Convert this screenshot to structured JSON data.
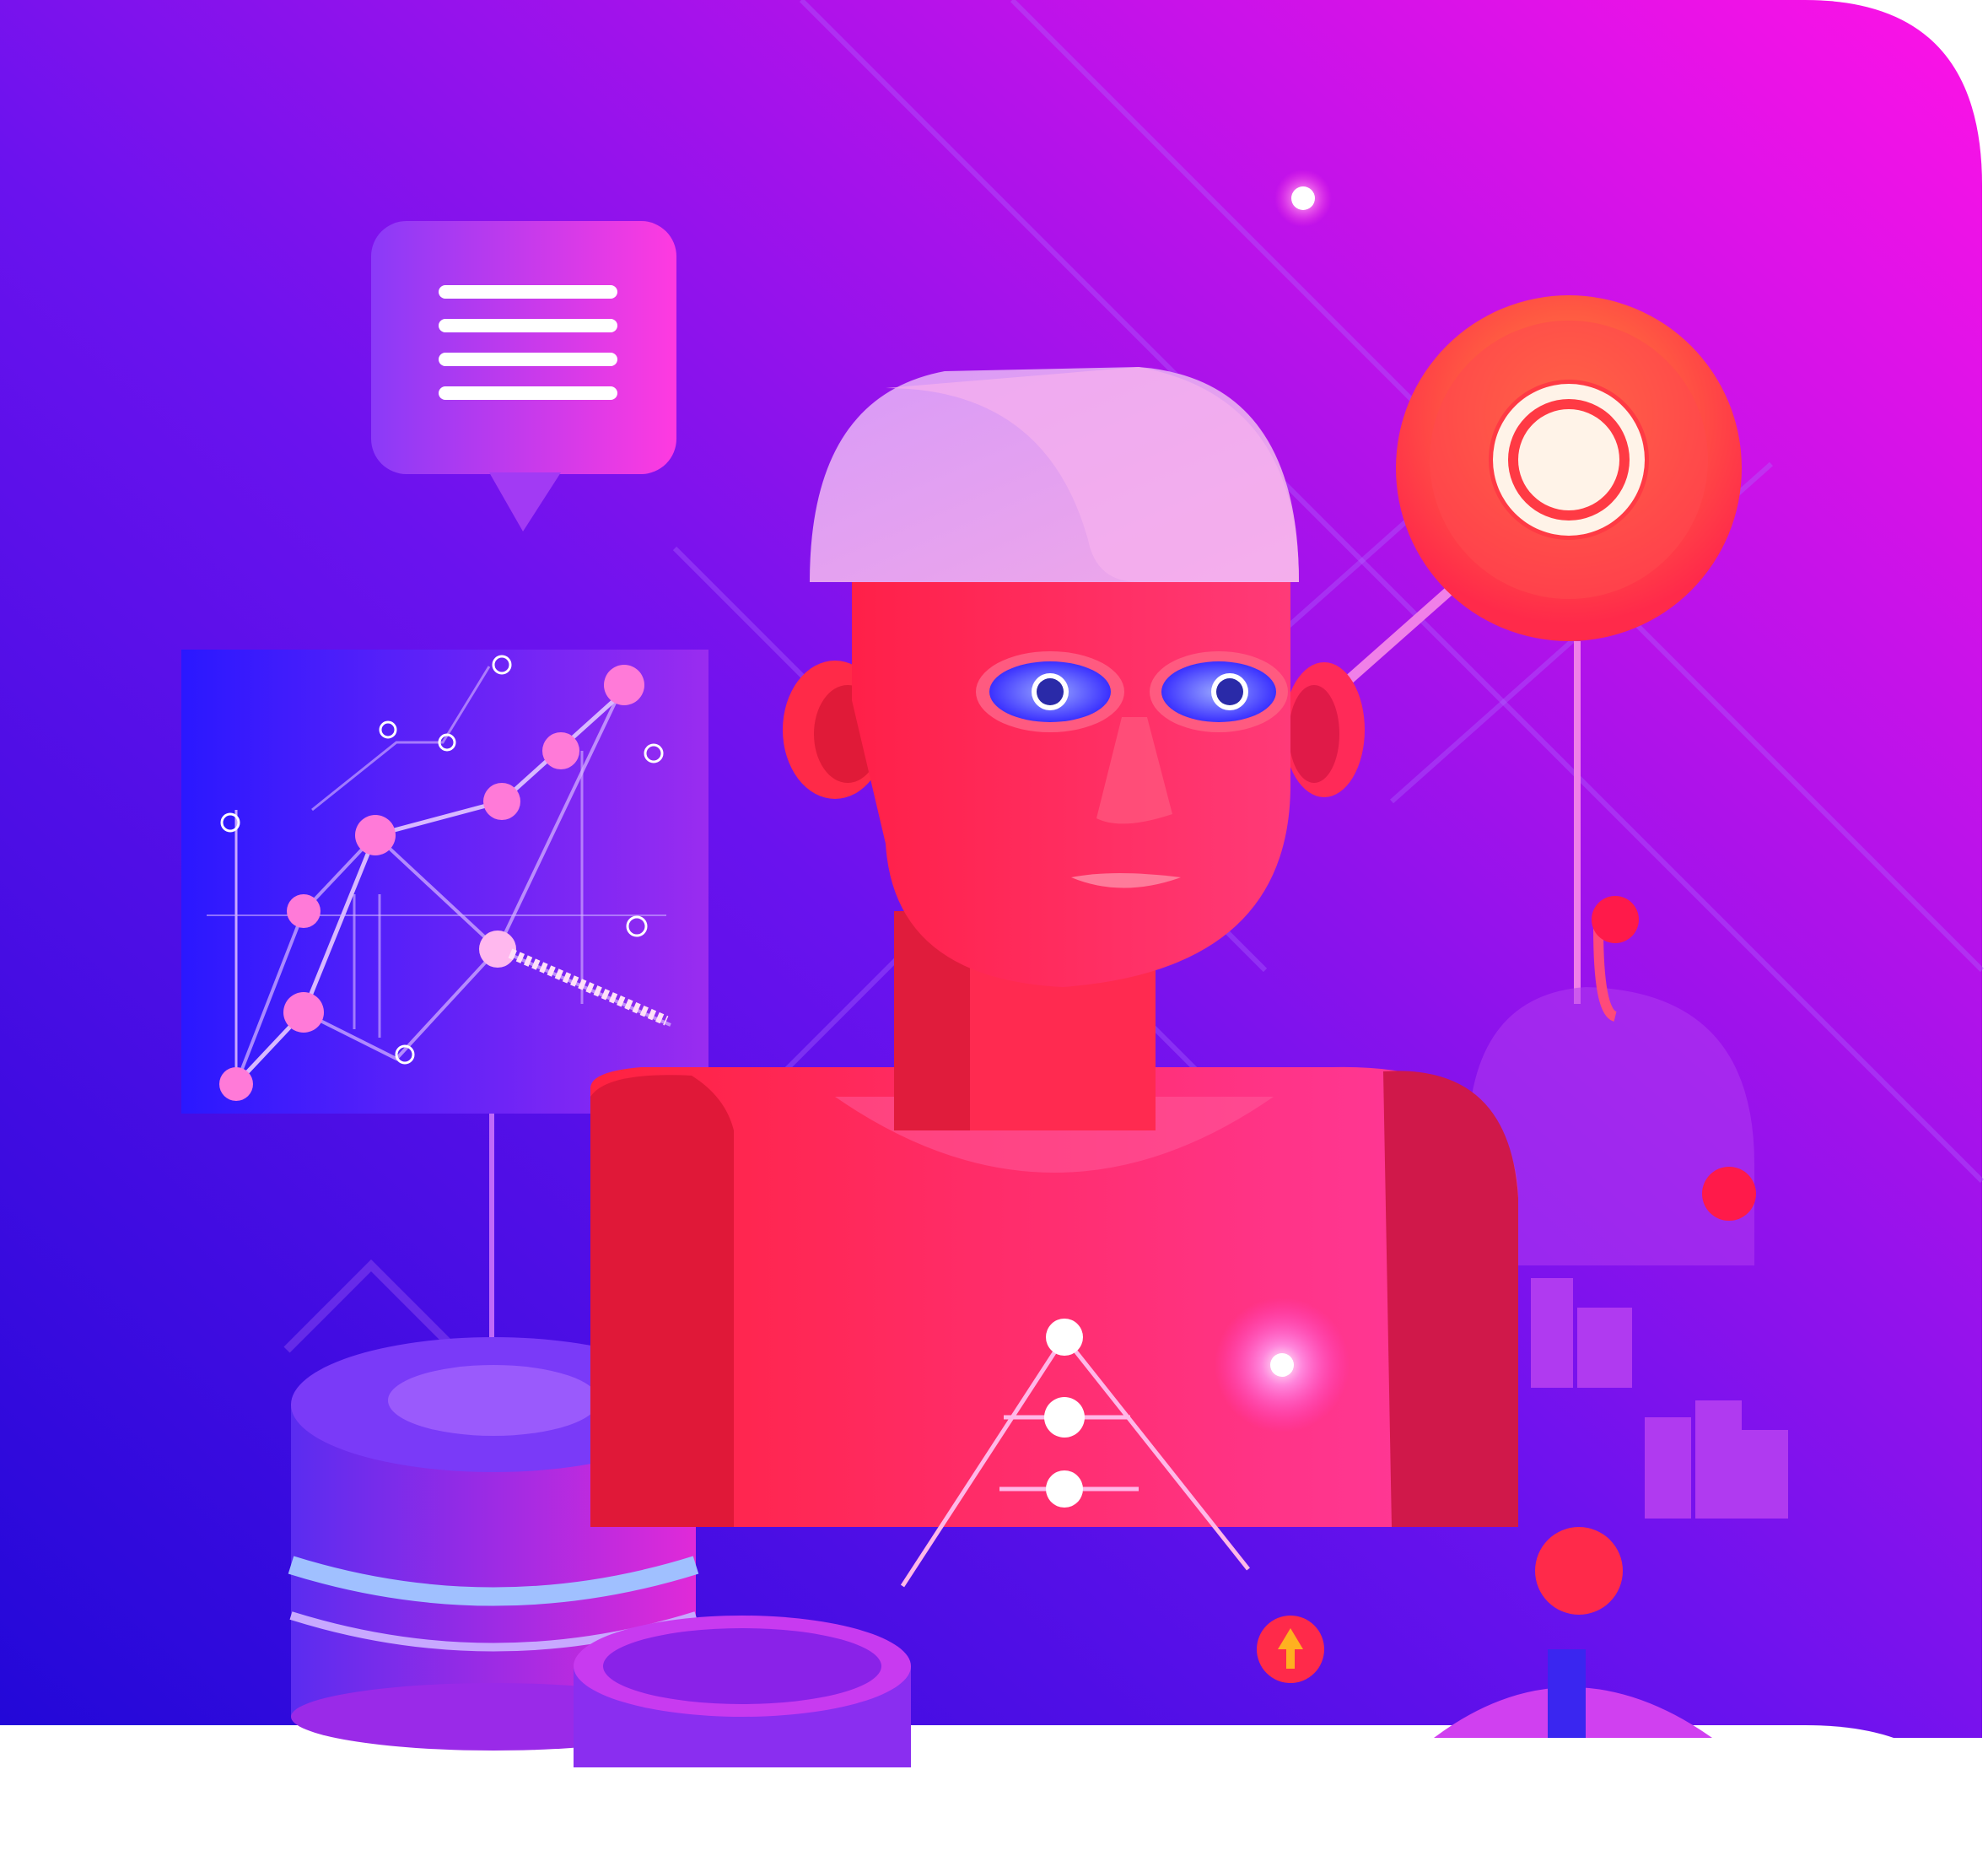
{
  "colors": {
    "bg_left": "#2a10e0",
    "bg_mid": "#7a10f0",
    "bg_right": "#ff10e8",
    "robot_red": "#ff2a55",
    "robot_hair": "#f0a0e8",
    "eye_blue": "#4a50ff",
    "glow": "#ffd0f8",
    "target_orange": "#ff6a3a",
    "target_center": "#fff3e8"
  },
  "icons": {
    "chat": "chat-bubble-icon",
    "target": "target-icon",
    "chart": "line-graph-icon",
    "database": "database-icon",
    "bars": "bar-chart-icon",
    "upload": "upload-arrow-icon"
  }
}
